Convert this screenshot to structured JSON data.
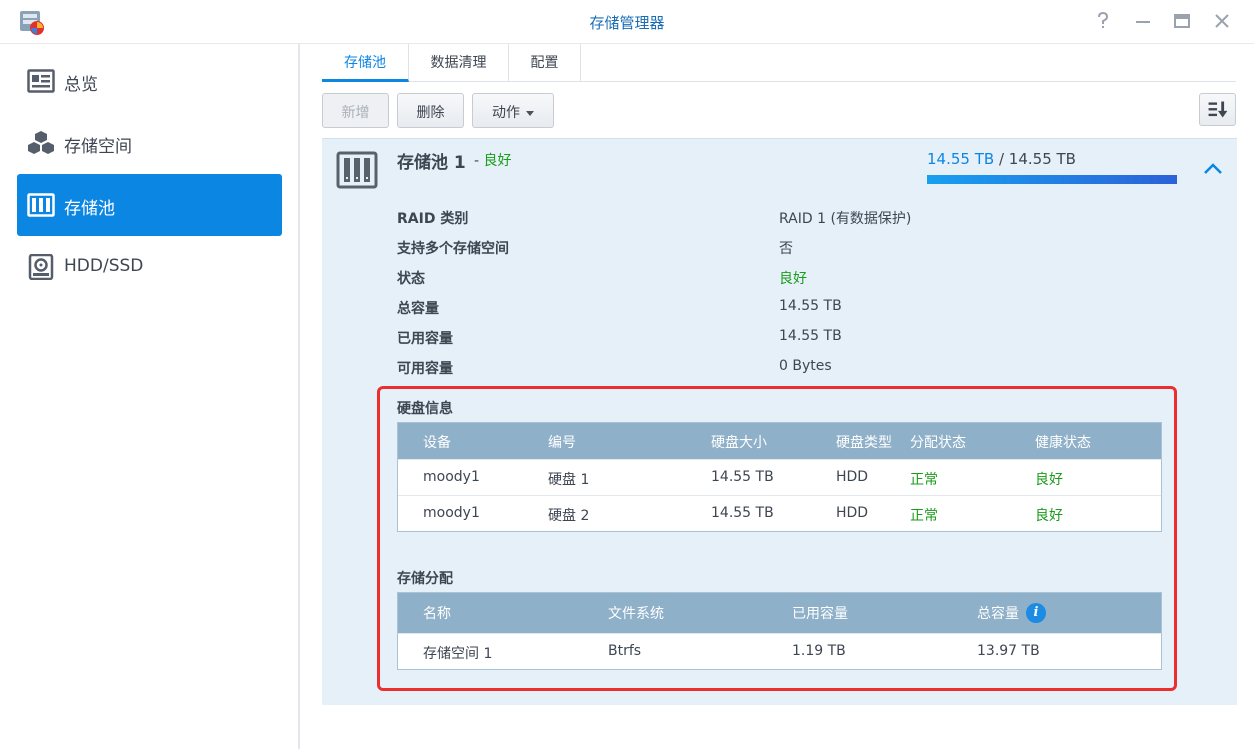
{
  "window": {
    "title": "存储管理器",
    "app_icon": "storage-manager-icon",
    "controls": [
      "help-icon",
      "minimize-icon",
      "maximize-icon",
      "close-icon"
    ]
  },
  "sidebar": {
    "items": [
      {
        "label": "总览",
        "icon": "overview-icon",
        "active": false
      },
      {
        "label": "存储空间",
        "icon": "cubes-icon",
        "active": false
      },
      {
        "label": "存储池",
        "icon": "storage-pool-icon",
        "active": true
      },
      {
        "label": "HDD/SSD",
        "icon": "hdd-icon",
        "active": false
      }
    ]
  },
  "tabs": [
    {
      "label": "存储池",
      "active": true
    },
    {
      "label": "数据清理",
      "active": false
    },
    {
      "label": "配置",
      "active": false
    }
  ],
  "toolbar": {
    "new_label": "新增",
    "delete_label": "删除",
    "action_label": "动作",
    "sort_icon": "sort-descending-icon"
  },
  "pool": {
    "name": "存储池 1",
    "status_sep": "-",
    "status": "良好",
    "used": "14.55 TB",
    "sep": "/",
    "total": "14.55 TB",
    "usage_fraction": 1.0,
    "properties": [
      {
        "label": "RAID 类别",
        "value": "RAID 1 (有数据保护)"
      },
      {
        "label": "支持多个存储空间",
        "value": "否"
      },
      {
        "label": "状态",
        "value": "良好"
      },
      {
        "label": "总容量",
        "value": "14.55 TB"
      },
      {
        "label": "已用容量",
        "value": "14.55 TB"
      },
      {
        "label": "可用容量",
        "value": "0 Bytes"
      }
    ]
  },
  "disk_info": {
    "title": "硬盘信息",
    "columns": [
      "设备",
      "编号",
      "硬盘大小",
      "硬盘类型",
      "分配状态",
      "健康状态"
    ],
    "rows": [
      [
        "moody1",
        "硬盘 1",
        "14.55 TB",
        "HDD",
        "正常",
        "良好"
      ],
      [
        "moody1",
        "硬盘 2",
        "14.55 TB",
        "HDD",
        "正常",
        "良好"
      ]
    ]
  },
  "allocation": {
    "title": "存储分配",
    "columns": [
      "名称",
      "文件系统",
      "已用容量",
      "总容量"
    ],
    "rows": [
      [
        "存储空间 1",
        "Btrfs",
        "1.19 TB",
        "13.97 TB"
      ]
    ],
    "info_icon": "info-icon"
  },
  "colors": {
    "accent": "#0b86e3",
    "good": "#1a9b1a",
    "panel_bg": "#e5f0f9",
    "table_header": "#8fb0c9",
    "highlight": "#ec2e2e"
  }
}
